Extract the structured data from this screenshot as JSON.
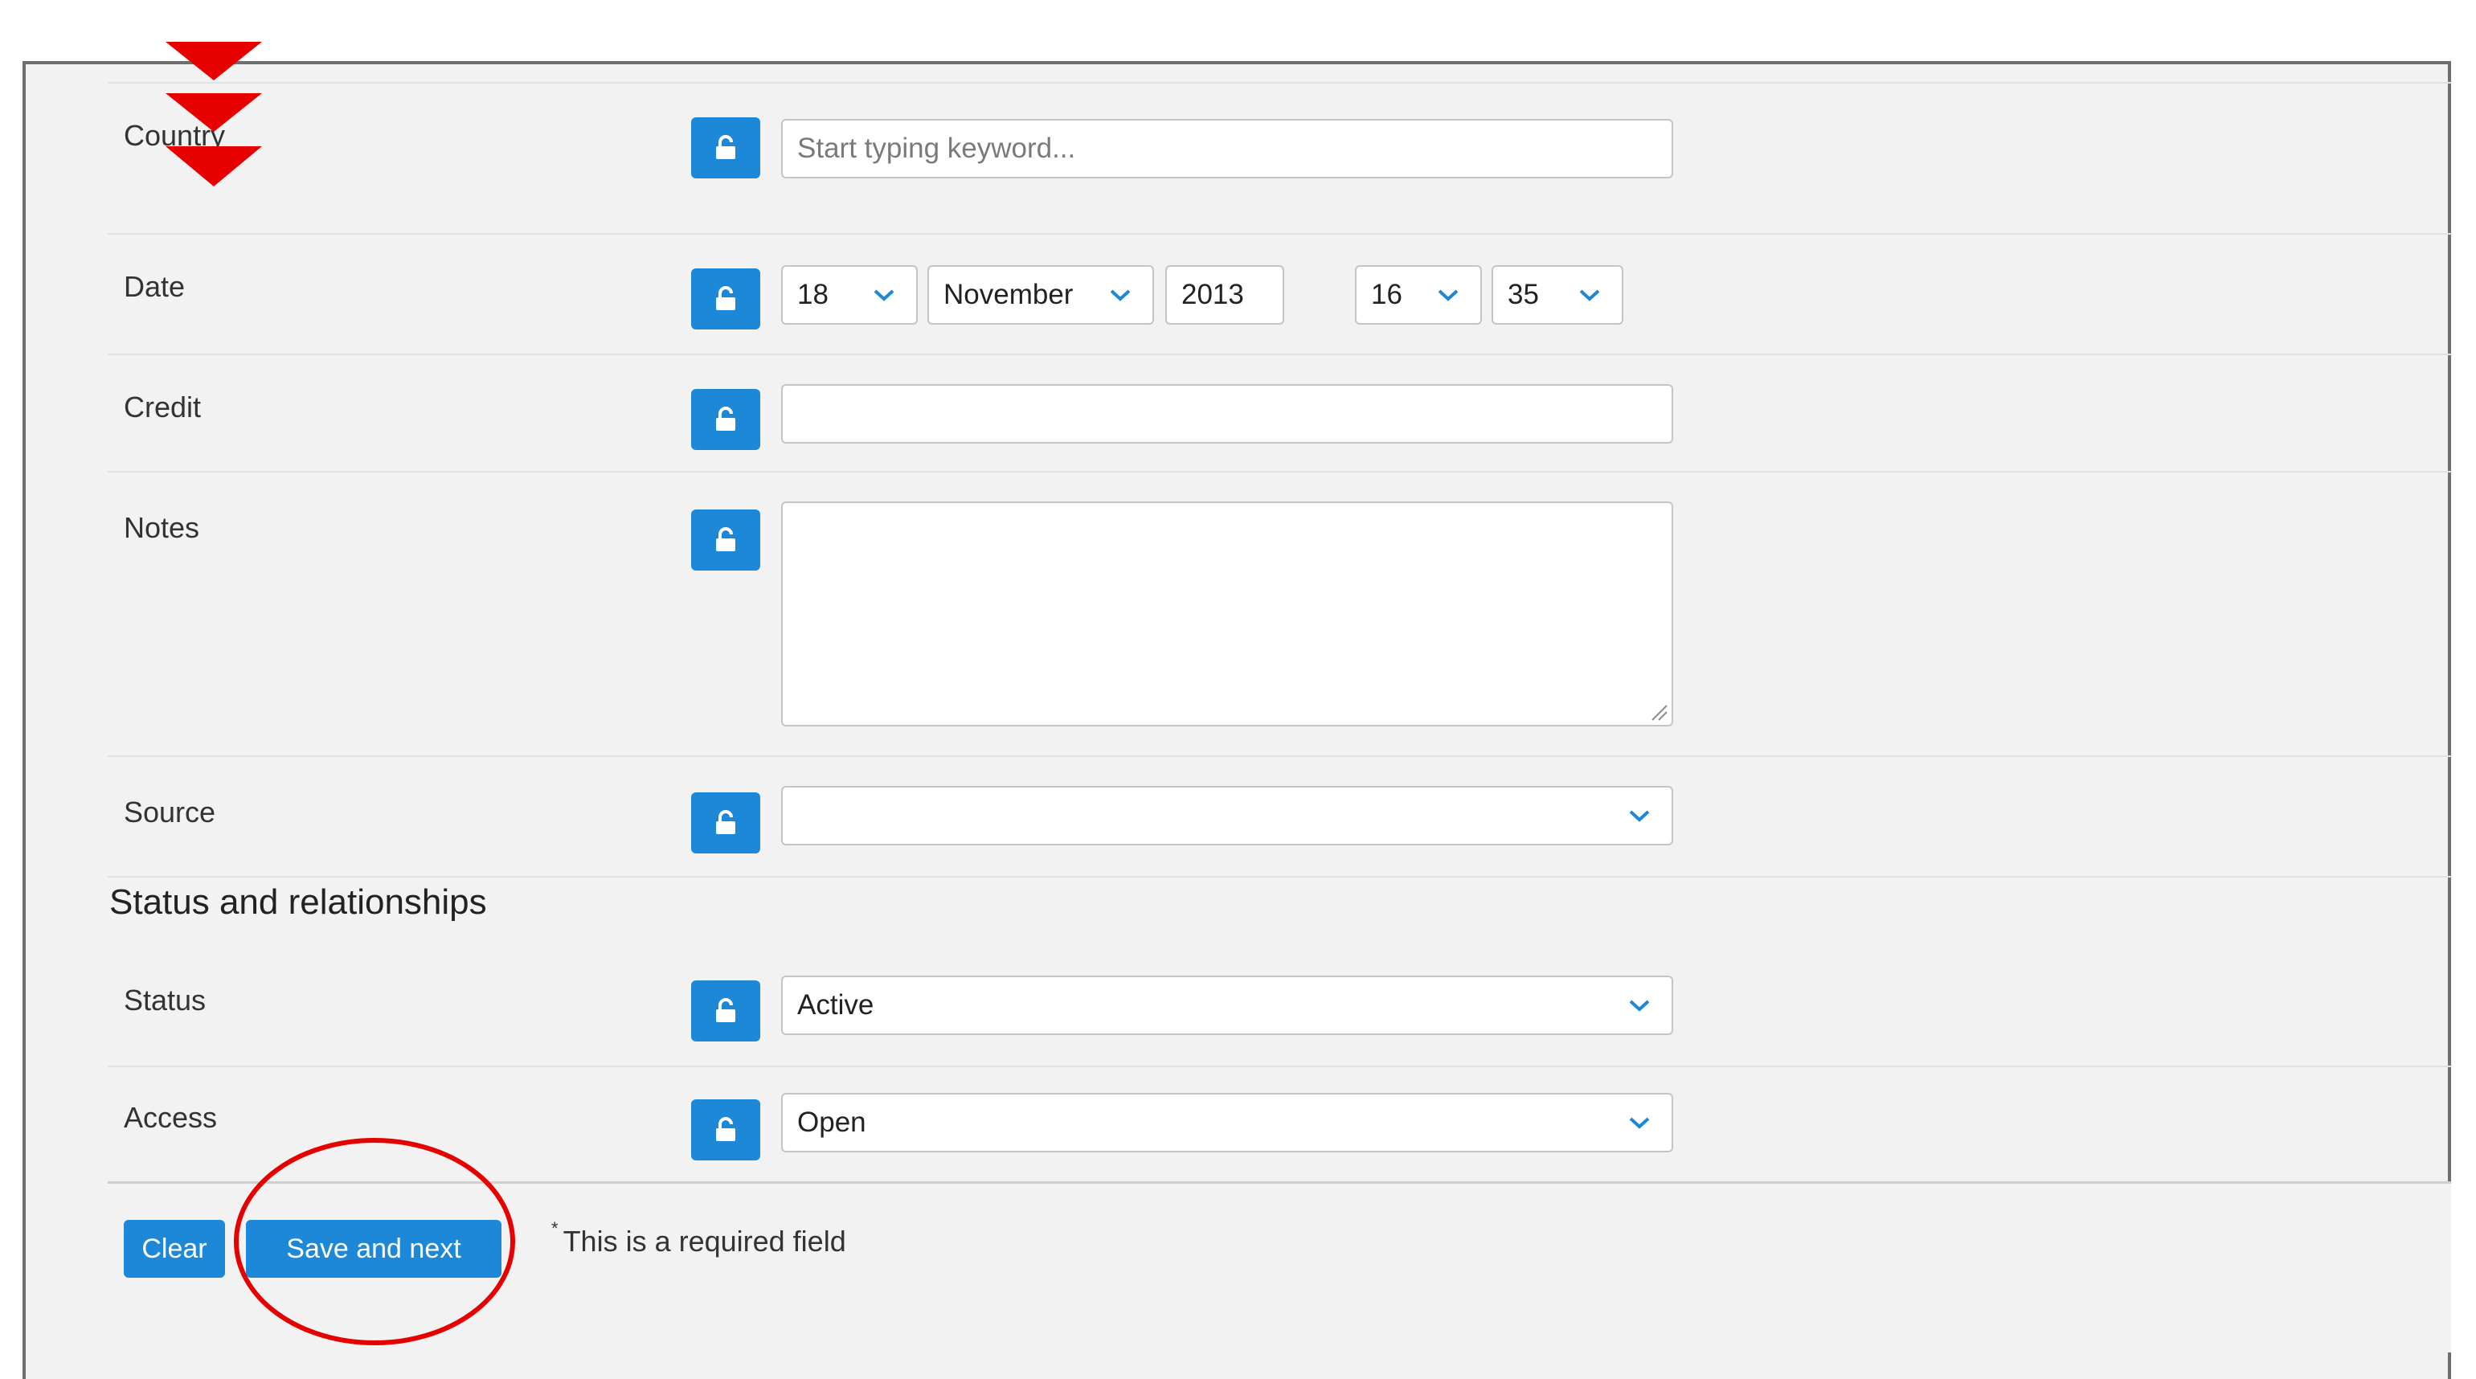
{
  "fields": {
    "country": {
      "label": "Country",
      "placeholder": "Start typing keyword..."
    },
    "date": {
      "label": "Date",
      "day": "18",
      "month": "November",
      "year": "2013",
      "hour": "16",
      "minute": "35"
    },
    "credit": {
      "label": "Credit",
      "value": ""
    },
    "notes": {
      "label": "Notes",
      "value": ""
    },
    "source": {
      "label": "Source",
      "value": ""
    }
  },
  "section": {
    "title": "Status and relationships"
  },
  "status": {
    "label": "Status",
    "value": "Active"
  },
  "access": {
    "label": "Access",
    "value": "Open"
  },
  "footer": {
    "clear_label": "Clear",
    "save_label": "Save and next",
    "required_marker": "*",
    "required_note": "This is a required field"
  },
  "colors": {
    "accent": "#1e88d8",
    "annotation": "#e60000",
    "panel": "#f2f2f2"
  },
  "icons": {
    "lock": "unlock-icon",
    "chevron": "chevron-down-icon"
  }
}
